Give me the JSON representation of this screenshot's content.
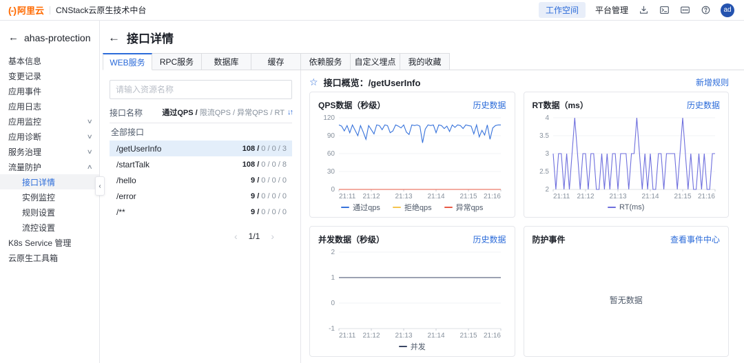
{
  "colors": {
    "accent": "#2b6bd9",
    "brand_orange": "#ff6a00",
    "qps_pass": "#3672db",
    "qps_block": "#f5c44e",
    "qps_error": "#e85a45",
    "rt_line": "#6d6edd",
    "concurrency_line": "#3a4664",
    "selected_row_bg": "#e3eefa"
  },
  "icons": {
    "back": "←",
    "chevron_down": "∨",
    "chevron_up": "∧",
    "star": "☆",
    "sort": "↓↑",
    "prev": "‹",
    "next": "›",
    "collapse": "‹",
    "help": "?"
  },
  "topbar": {
    "logo_mark": "(-)",
    "logo_text": "阿里云",
    "product": "CNStack云原生技术中台",
    "workspace_btn": "工作空间",
    "platform_btn": "平台管理",
    "avatar": "ad"
  },
  "sidebar": {
    "app_name": "ahas-protection",
    "items": [
      {
        "label": "基本信息"
      },
      {
        "label": "变更记录"
      },
      {
        "label": "应用事件"
      },
      {
        "label": "应用日志"
      },
      {
        "label": "应用监控",
        "chevron": "down"
      },
      {
        "label": "应用诊断",
        "chevron": "down"
      },
      {
        "label": "服务治理",
        "chevron": "down"
      },
      {
        "label": "流量防护",
        "chevron": "up"
      },
      {
        "label": "接口详情",
        "child": true,
        "active": true
      },
      {
        "label": "实例监控",
        "child": true
      },
      {
        "label": "规则设置",
        "child": true
      },
      {
        "label": "流控设置",
        "child": true
      },
      {
        "label": "K8s Service 管理"
      },
      {
        "label": "云原生工具箱"
      }
    ]
  },
  "page": {
    "title": "接口详情",
    "tabs": [
      {
        "label": "WEB服务",
        "active": true
      },
      {
        "label": "RPC服务"
      },
      {
        "label": "数据库"
      },
      {
        "label": "缓存"
      },
      {
        "label": "依赖服务"
      },
      {
        "label": "自定义埋点"
      },
      {
        "label": "我的收藏"
      }
    ]
  },
  "interface_list": {
    "search_placeholder": "请输入资源名称",
    "name_header": "接口名称",
    "sort_primary": "通过QPS /",
    "sort_rest": " 限流QPS / 异常QPS / RT",
    "group_label": "全部接口",
    "rows": [
      {
        "name": "/getUserInfo",
        "primary": "108",
        "rest": "0 / 0 / 3",
        "selected": true
      },
      {
        "name": "/startTalk",
        "primary": "108",
        "rest": "0 / 0 / 8",
        "selected": false
      },
      {
        "name": "/hello",
        "primary": "9",
        "rest": "0 / 0 / 0",
        "selected": false
      },
      {
        "name": "/error",
        "primary": "9",
        "rest": "0 / 0 / 0",
        "selected": false
      },
      {
        "name": "/**",
        "primary": "9",
        "rest": "0 / 0 / 0",
        "selected": false
      }
    ],
    "pagination": "1/1"
  },
  "overview": {
    "title": "接口概览：/getUserInfo",
    "new_rule_link": "新增规则"
  },
  "empty_panel": {
    "title": "防护事件",
    "link": "查看事件中心",
    "empty_text": "暂无数据"
  },
  "chart_data": [
    {
      "type": "line",
      "title": "QPS数据（秒级）",
      "link": "历史数据",
      "x_ticks": [
        "21:11",
        "21:12",
        "21:13",
        "21:14",
        "21:15",
        "21:16"
      ],
      "ylim": [
        0,
        120
      ],
      "y_ticks": [
        0,
        30,
        60,
        90,
        120
      ],
      "grid": true,
      "legend_position": "bottom",
      "series": [
        {
          "name": "通过qps",
          "color": "#3672db",
          "values": [
            108,
            106,
            98,
            107,
            95,
            108,
            99,
            90,
            107,
            96,
            84,
            107,
            100,
            93,
            108,
            107,
            100,
            108,
            107,
            95,
            98,
            108,
            106,
            103,
            108,
            96,
            92,
            108,
            107,
            108,
            106,
            78,
            101,
            108,
            107,
            108,
            95,
            108,
            107,
            102,
            106,
            97,
            108,
            104,
            108,
            107,
            102,
            108,
            107,
            106,
            93,
            108,
            88,
            99,
            91,
            108,
            84,
            103,
            107,
            108,
            108
          ]
        },
        {
          "name": "拒绝qps",
          "color": "#f5c44e",
          "values": [
            0,
            0
          ]
        },
        {
          "name": "异常qps",
          "color": "#e85a45",
          "values": [
            0,
            0
          ]
        }
      ]
    },
    {
      "type": "line",
      "title": "RT数据（ms）",
      "link": "历史数据",
      "x_ticks": [
        "21:11",
        "21:12",
        "21:13",
        "21:14",
        "21:15",
        "21:16"
      ],
      "ylim": [
        2,
        4
      ],
      "y_ticks": [
        2,
        2.5,
        3,
        3.5,
        4
      ],
      "grid": true,
      "legend_position": "bottom",
      "series": [
        {
          "name": "RT(ms)",
          "color": "#6d6edd",
          "values": [
            3,
            2,
            3,
            3,
            2,
            3,
            2,
            3,
            4,
            3,
            2,
            3,
            3,
            2,
            3,
            3,
            2,
            2,
            3,
            2,
            3,
            2,
            3,
            3,
            2,
            3,
            3,
            3,
            2,
            3,
            3,
            4,
            3,
            2,
            3,
            2,
            3,
            2,
            2,
            3,
            3,
            2,
            3,
            3,
            3,
            3,
            2,
            3,
            4,
            3,
            2,
            3,
            2,
            2,
            3,
            2,
            3,
            2,
            2,
            3,
            3
          ]
        }
      ]
    },
    {
      "type": "line",
      "title": "并发数据（秒级）",
      "link": "历史数据",
      "x_ticks": [
        "21:11",
        "21:12",
        "21:13",
        "21:14",
        "21:15",
        "21:16"
      ],
      "ylim": [
        -1,
        2
      ],
      "y_ticks": [
        -1,
        0,
        1,
        2
      ],
      "grid": true,
      "legend_position": "bottom",
      "series": [
        {
          "name": "并发",
          "color": "#3a4664",
          "values": [
            1,
            1
          ]
        }
      ]
    }
  ]
}
